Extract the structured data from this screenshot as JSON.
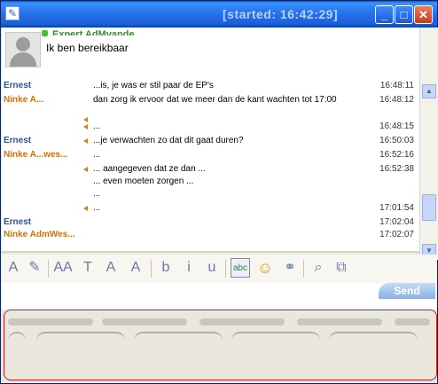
{
  "window": {
    "title": "[started: 16:42:29]",
    "min_glyph": "_",
    "max_glyph": "□",
    "close_glyph": "✕"
  },
  "contact": {
    "name": "Expert AdMvande",
    "status_message": "Ik ben bereikbaar"
  },
  "messages": [
    {
      "sender": "Ernest",
      "sender_color": "#3050a0",
      "text": "...is, je was er stil paar de EP's",
      "time": "16:48:11",
      "arrow": false
    },
    {
      "sender": "Ninke A...",
      "sender_color": "#d07010",
      "text": "dan zorg ik ervoor dat we meer dan de kant wachten tot 17:00",
      "time": "16:48:12",
      "arrow": false
    },
    {
      "sender": "",
      "sender_color": "#000000",
      "text": "",
      "time": "",
      "arrow": true
    },
    {
      "sender": "",
      "sender_color": "#000000",
      "text": "...",
      "time": "16:48:15",
      "arrow": true
    },
    {
      "sender": "Ernest",
      "sender_color": "#3050a0",
      "text": "...je verwachten zo dat dit gaat duren?",
      "time": "16:50:03",
      "arrow": true
    },
    {
      "sender": "Ninke A...wes...",
      "sender_color": "#d07010",
      "text": "...",
      "time": "16:52:16",
      "arrow": false
    },
    {
      "sender": "",
      "sender_color": "#000000",
      "text": "... aangegeven dat ze dan ...",
      "time": "16:52:38",
      "arrow": true
    },
    {
      "sender": "",
      "sender_color": "#000000",
      "text": "... even moeten zorgen ...",
      "time": "",
      "arrow": false
    },
    {
      "sender": "",
      "sender_color": "#000000",
      "text": "...",
      "time": "",
      "arrow": false
    },
    {
      "sender": "",
      "sender_color": "#000000",
      "text": "...",
      "time": "17:01:54",
      "arrow": true
    },
    {
      "sender": "Ernest",
      "sender_color": "#3050a0",
      "text": "",
      "time": "17:02:04",
      "arrow": false
    },
    {
      "sender": "Ninke AdmWes...",
      "sender_color": "#d07010",
      "text": "",
      "time": "17:02:07",
      "arrow": false
    }
  ],
  "toolbar": {
    "icons": [
      "font-color-icon",
      "pen-icon",
      "font-style-icon",
      "font-icon",
      "font-grow-icon",
      "font-shrink-icon",
      "bold-icon",
      "italic-icon",
      "underline-icon",
      "spellcheck-icon",
      "emoticon-icon",
      "link-icon",
      "attach-icon",
      "screenshot-icon"
    ],
    "glyphs": [
      "A",
      "✎",
      "AA",
      "T",
      "A",
      "A",
      "b",
      "i",
      "u",
      "abc",
      "☺",
      "⚭",
      "⌕",
      "⧉"
    ]
  },
  "send_label": "Send"
}
